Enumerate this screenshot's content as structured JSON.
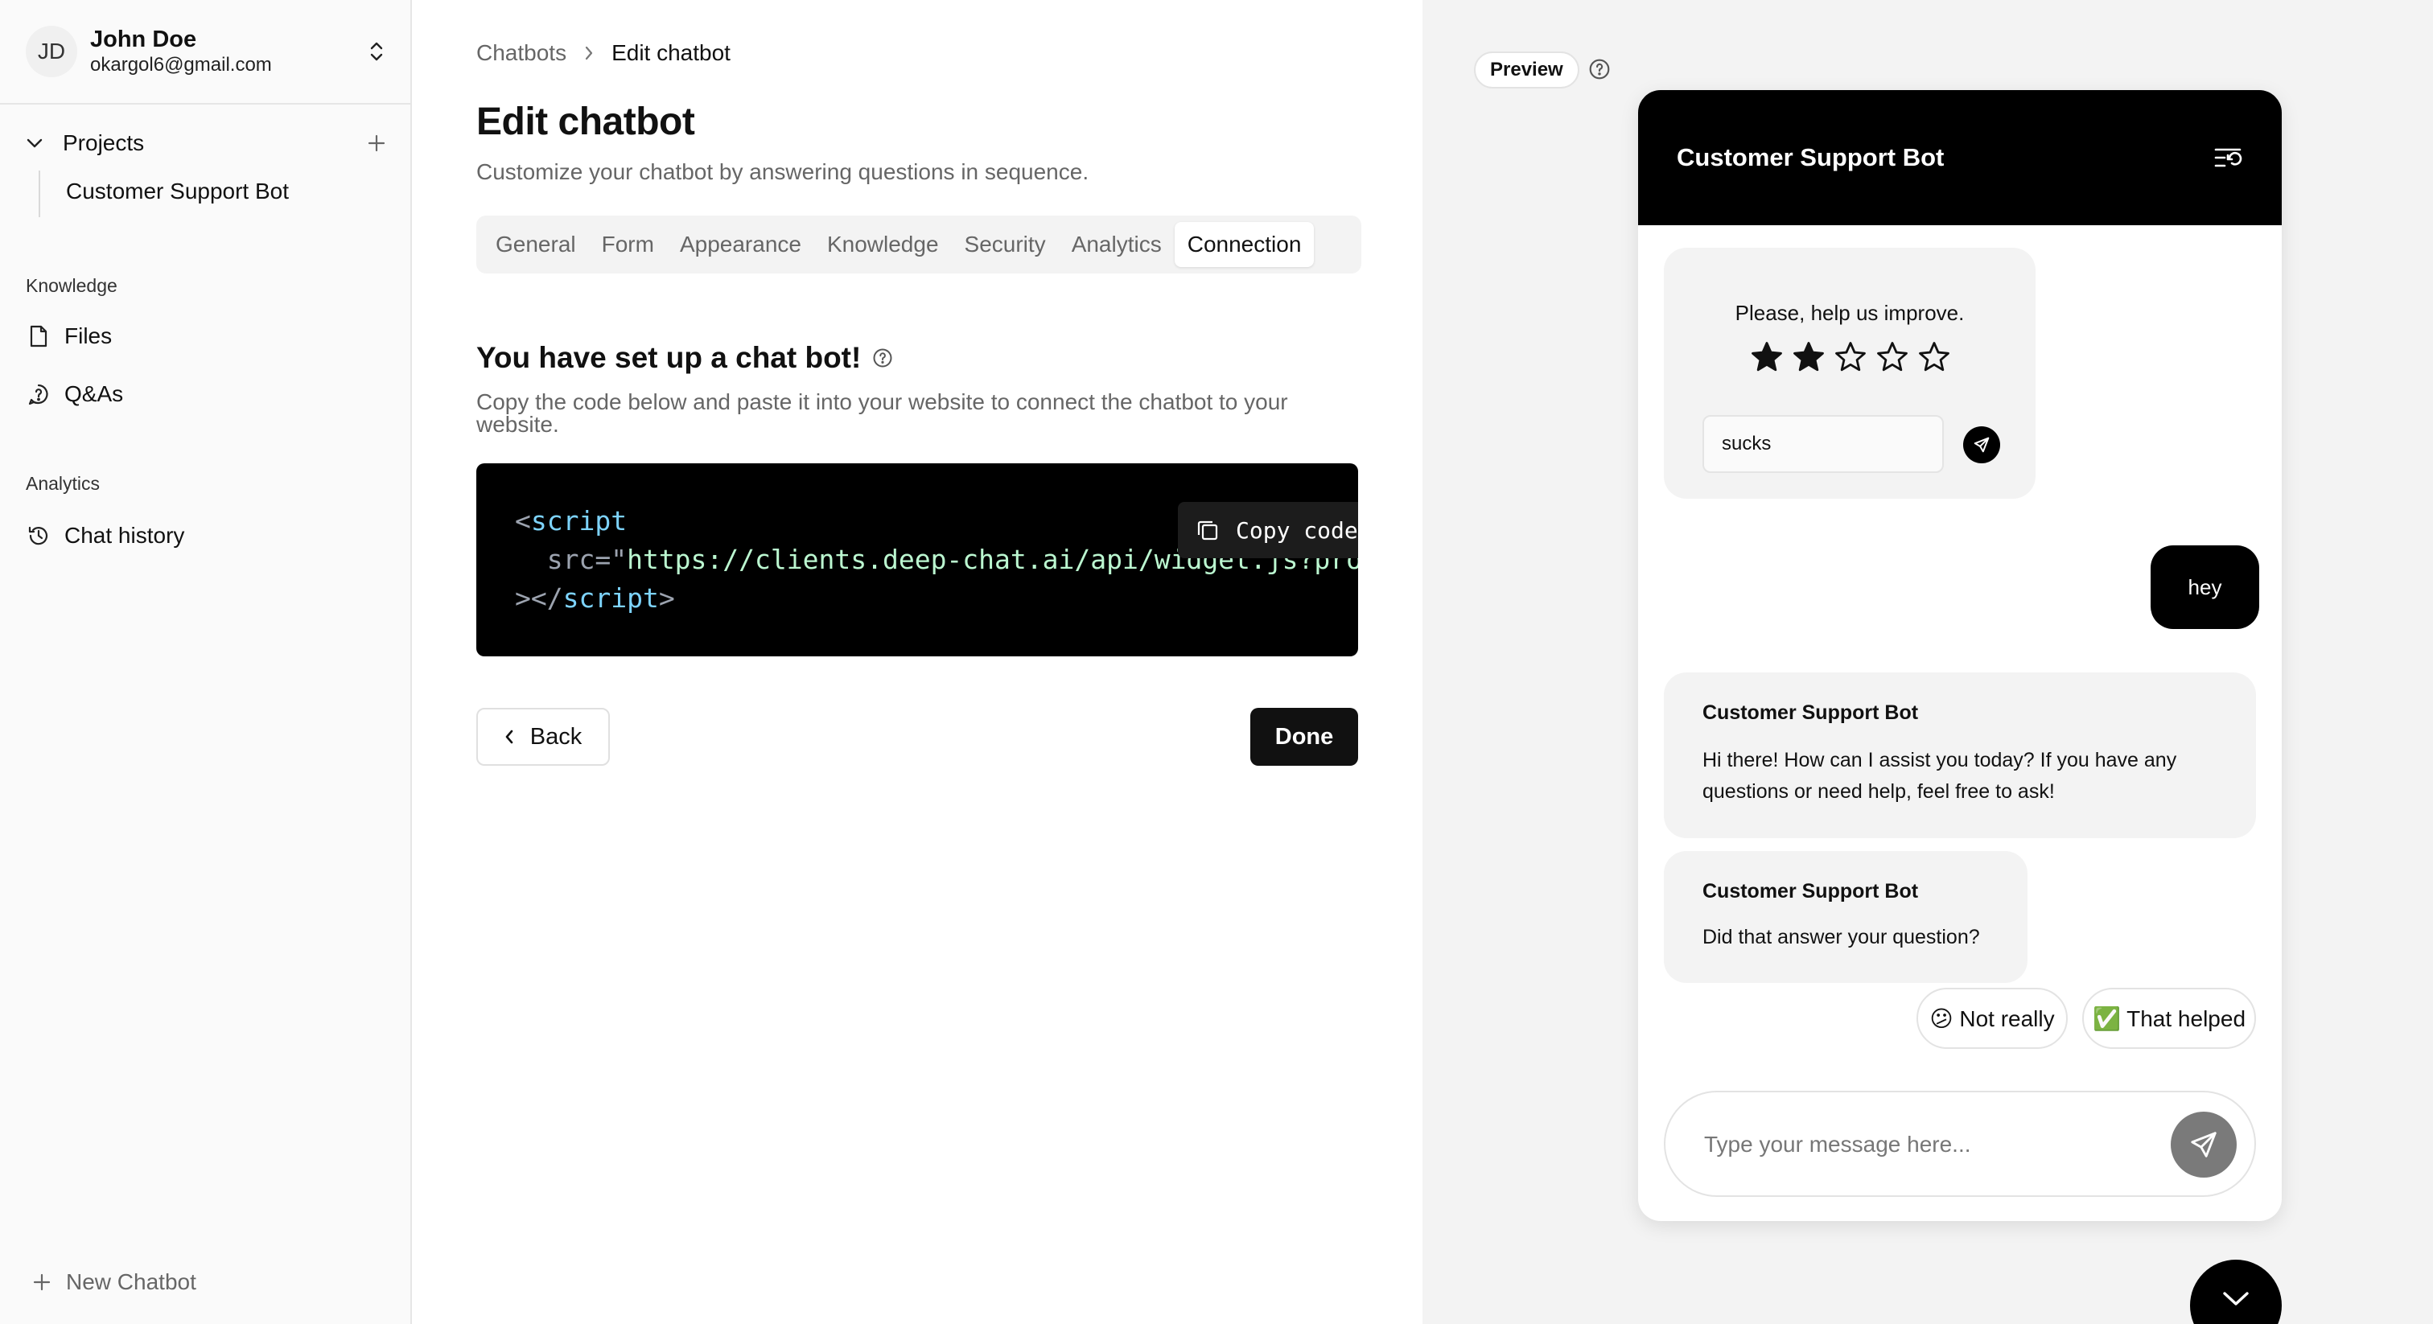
{
  "user": {
    "initials": "JD",
    "name": "John Doe",
    "email": "okargol6@gmail.com"
  },
  "sidebar": {
    "projects_label": "Projects",
    "project_item": "Customer Support Bot",
    "knowledge_label": "Knowledge",
    "files_label": "Files",
    "qas_label": "Q&As",
    "analytics_label": "Analytics",
    "chat_history_label": "Chat history",
    "new_chatbot_label": "New Chatbot"
  },
  "breadcrumb": {
    "parent": "Chatbots",
    "current": "Edit chatbot"
  },
  "page": {
    "title": "Edit chatbot",
    "subtitle": "Customize your chatbot by answering questions in sequence."
  },
  "tabs": [
    "General",
    "Form",
    "Appearance",
    "Knowledge",
    "Security",
    "Analytics",
    "Connection"
  ],
  "active_tab": "Connection",
  "setup": {
    "title": "You have set up a chat bot!",
    "description": "Copy the code below and paste it into your website to connect the chatbot to your website.",
    "code_line1_tag": "<",
    "code_line1_name": "script",
    "code_line2_attr": "  src=\"",
    "code_line2_value": "https://clients.deep-chat.ai/api/widget.js?proje",
    "code_line3_tag": "></",
    "code_line3_name": "script",
    "code_line3_end": ">",
    "copy_label": "Copy code"
  },
  "actions": {
    "back_label": "Back",
    "done_label": "Done"
  },
  "preview": {
    "chip_label": "Preview",
    "chat_title": "Customer Support Bot",
    "rating_prompt": "Please, help us improve.",
    "rating_value": 2,
    "rating_max": 5,
    "feedback_value": "sucks",
    "user_message": "hey",
    "bot_name": "Customer Support Bot",
    "bot_message_1": "Hi there! How can I assist you today? If you have any questions or need help, feel free to ask!",
    "bot_message_2": "Did that answer your question?",
    "quick_reply_1": "😕 Not really",
    "quick_reply_2": "✅ That helped",
    "input_placeholder": "Type your message here..."
  },
  "colors": {
    "accent": "#000000",
    "muted_text": "#666666",
    "preview_bg": "#f3f3f3"
  }
}
